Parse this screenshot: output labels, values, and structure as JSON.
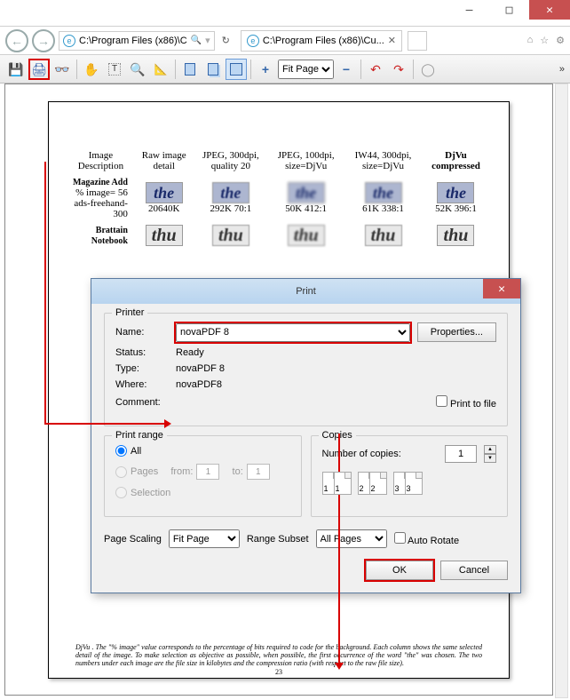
{
  "window": {
    "min": "—",
    "max": "□",
    "close": "✕"
  },
  "nav": {
    "back": "←",
    "fwd": "→",
    "address": "C:\\Program Files (x86)\\C",
    "search_glyph": "🔍",
    "refresh_glyph": "↻",
    "tab_title": "C:\\Program Files (x86)\\Cu...",
    "tab_close": "✕",
    "home_glyph": "⌂",
    "star_glyph": "☆",
    "gear_glyph": "⚙"
  },
  "toolbar": {
    "save_glyph": "💾",
    "print_glyph": "🖨",
    "find_glyph": "🔎",
    "hand_glyph": "✋",
    "text_glyph": "T",
    "zoomr_glyph": "🔍",
    "scale_glyph": "📏",
    "page1": "▭",
    "page2": "▭",
    "page3": "▣",
    "plus": "+",
    "zoom_val": "Fit Page",
    "minus": "−",
    "rotl": "↺",
    "rotr": "↻",
    "opt": "◌",
    "more": "»"
  },
  "doc": {
    "headers": [
      "Image Description",
      "Raw image detail",
      "JPEG, 300dpi, quality 20",
      "JPEG, 100dpi, size=DjVu",
      "IW44, 300dpi, size=DjVu",
      "DjVu compressed"
    ],
    "row1_label_b": "Magazine Add",
    "row1_label_s1": "% image= 56",
    "row1_label_s2": "ads-freehand-300",
    "row1_vals": [
      "20640K",
      "292K 70:1",
      "50K 412:1",
      "61K 338:1",
      "52K 396:1"
    ],
    "row2_label_b": "Brattain Notebook",
    "sample": "the",
    "sample2": "thu",
    "footer": "DjVu . The \"% image\" value corresponds to the percentage of bits required to code for the background. Each column shows the same selected detail of the image. To make selection as objective as possible, when possible, the first occurrence of the word \"the\" was chosen. The two numbers under each image are the file size in kilobytes and the compression ratio (with respect to the raw file size).",
    "page_num": "23"
  },
  "dlg": {
    "title": "Print",
    "printer_grp": "Printer",
    "name_lbl": "Name:",
    "name_val": "novaPDF 8",
    "props_btn": "Properties...",
    "status_lbl": "Status:",
    "status_val": "Ready",
    "type_lbl": "Type:",
    "type_val": "novaPDF 8",
    "where_lbl": "Where:",
    "where_val": "novaPDF8",
    "comment_lbl": "Comment:",
    "ptf_lbl": "Print to file",
    "range_grp": "Print range",
    "all_lbl": "All",
    "pages_lbl": "Pages",
    "from_lbl": "from:",
    "to_lbl": "to:",
    "from_val": "1",
    "to_val": "1",
    "sel_lbl": "Selection",
    "copies_grp": "Copies",
    "ncop_lbl": "Number of copies:",
    "ncop_val": "1",
    "cp": [
      "1",
      "1",
      "2",
      "2",
      "3",
      "3"
    ],
    "scale_lbl": "Page Scaling",
    "scale_val": "Fit Page",
    "subset_lbl": "Range Subset",
    "subset_val": "All Pages",
    "autorot_lbl": "Auto Rotate",
    "ok": "OK",
    "cancel": "Cancel"
  }
}
